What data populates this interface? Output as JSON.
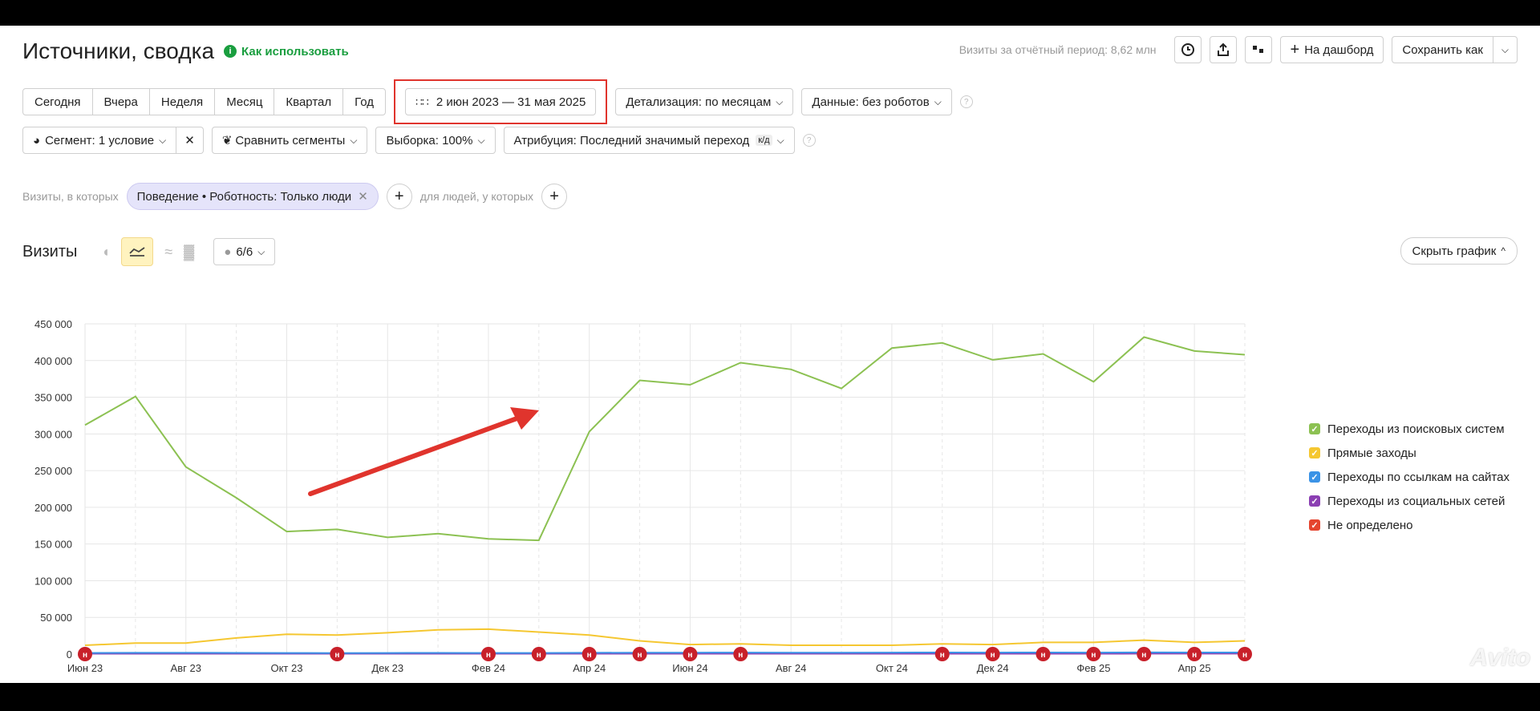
{
  "header": {
    "title": "Источники, сводка",
    "how_to_use": "Как использовать",
    "visits_period": "Визиты за отчётный период: 8,62 млн",
    "dashboard_label": "На дашборд",
    "save_as_label": "Сохранить как"
  },
  "period_tabs": [
    "Сегодня",
    "Вчера",
    "Неделя",
    "Месяц",
    "Квартал",
    "Год"
  ],
  "date_range": "2 июн 2023 — 31 мая 2025",
  "detail_label": "Детализация: по месяцам",
  "data_label": "Данные: без роботов",
  "filters": {
    "segment": "Сегмент: 1 условие",
    "compare": "Сравнить сегменты",
    "sample": "Выборка: 100%",
    "attribution": "Атрибуция: Последний значимый переход",
    "attribution_badge": "к/д"
  },
  "condition": {
    "prefix": "Визиты, в которых",
    "chip": "Поведение • Роботность: Только люди",
    "suffix": "для людей, у которых"
  },
  "visits_title": "Визиты",
  "annotations_count": "6/6",
  "hide_chart": "Скрыть график",
  "watermark": "Avito",
  "colors": {
    "search": "#8cc152",
    "direct": "#f5c731",
    "links": "#3b93e6",
    "social": "#8b3fb3",
    "unknown": "#e5452f",
    "accent_red": "#e0342d"
  },
  "chart_data": {
    "type": "line",
    "x": [
      "Июн 23",
      "Июл 23",
      "Авг 23",
      "Сен 23",
      "Окт 23",
      "Ноя 23",
      "Дек 23",
      "Янв 24",
      "Фев 24",
      "Мар 24",
      "Апр 24",
      "Май 24",
      "Июн 24",
      "Июл 24",
      "Авг 24",
      "Сен 24",
      "Окт 24",
      "Ноя 24",
      "Дек 24",
      "Янв 25",
      "Фев 25",
      "Мар 25",
      "Апр 25",
      "Май 25"
    ],
    "x_tick_labels": [
      "Июн 23",
      "Авг 23",
      "Окт 23",
      "Дек 23",
      "Фев 24",
      "Апр 24",
      "Июн 24",
      "Авг 24",
      "Окт 24",
      "Дек 24",
      "Фев 25",
      "Апр 25"
    ],
    "y_tick_labels": [
      "0",
      "50 000",
      "100 000",
      "150 000",
      "200 000",
      "250 000",
      "300 000",
      "350 000",
      "400 000",
      "450 000"
    ],
    "ylim": [
      0,
      450000
    ],
    "series": [
      {
        "name": "Переходы из поисковых систем",
        "color": "#8cc152",
        "values": [
          312000,
          351000,
          255000,
          213000,
          167000,
          170000,
          159000,
          164000,
          157000,
          155000,
          303000,
          373000,
          367000,
          397000,
          388000,
          362000,
          417000,
          424000,
          401000,
          409000,
          371000,
          432000,
          413000,
          408000
        ]
      },
      {
        "name": "Прямые заходы",
        "color": "#f5c731",
        "values": [
          12000,
          15000,
          15000,
          22000,
          27000,
          26000,
          29000,
          33000,
          34000,
          30000,
          26000,
          18000,
          13000,
          14000,
          12000,
          12000,
          12000,
          14000,
          13000,
          16000,
          16000,
          19000,
          16000,
          18000
        ]
      },
      {
        "name": "Переходы по ссылкам на сайтах",
        "color": "#3b93e6",
        "values": [
          1500,
          1800,
          1700,
          1600,
          1500,
          1400,
          1500,
          1600,
          1500,
          1500,
          1800,
          2000,
          2000,
          2100,
          2000,
          2000,
          2100,
          2200,
          2100,
          2200,
          2100,
          2300,
          2200,
          2200
        ]
      },
      {
        "name": "Переходы из социальных сетей",
        "color": "#8b3fb3",
        "values": [
          500,
          600,
          500,
          500,
          500,
          500,
          500,
          500,
          500,
          500,
          600,
          600,
          600,
          600,
          600,
          600,
          600,
          600,
          600,
          600,
          600,
          700,
          700,
          700
        ]
      },
      {
        "name": "Не определено",
        "color": "#e5452f",
        "values": [
          800,
          900,
          800,
          800,
          800,
          800,
          900,
          900,
          900,
          900,
          1000,
          1000,
          1000,
          1000,
          1000,
          1000,
          1000,
          1100,
          1100,
          1100,
          1100,
          1100,
          1100,
          1100
        ]
      }
    ],
    "grid": true,
    "legend_position": "right"
  }
}
